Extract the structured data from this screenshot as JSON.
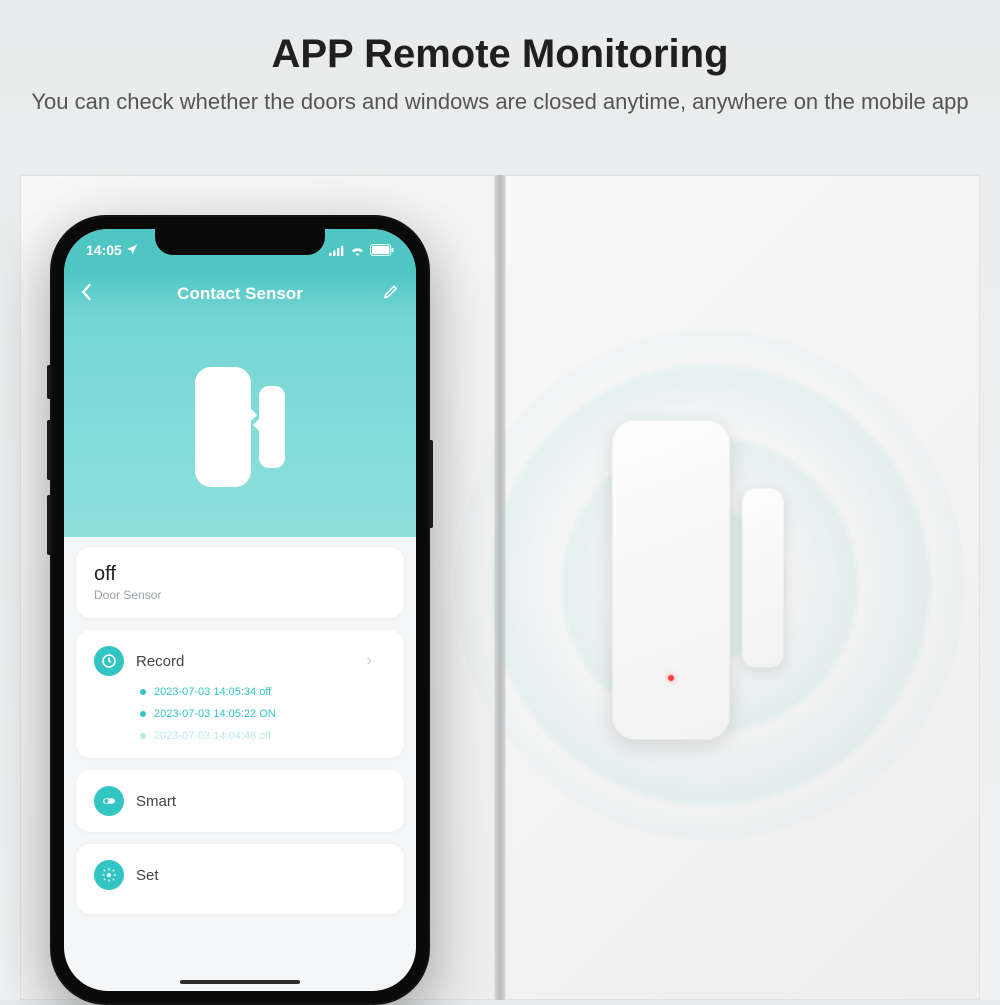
{
  "heading": {
    "title": "APP Remote Monitoring",
    "subtitle": "You can check whether the doors and windows are closed anytime, anywhere on the mobile app"
  },
  "phone": {
    "status_time": "14:05",
    "app_title": "Contact Sensor",
    "status_card": {
      "state": "off",
      "label": "Door Sensor"
    },
    "sections": {
      "record": {
        "label": "Record",
        "entries": [
          "2023-07-03 14:05:34 off",
          "2023-07-03 14:05:22 ON",
          "2023-07-03 14:04:48 off"
        ]
      },
      "smart": {
        "label": "Smart"
      },
      "set": {
        "label": "Set"
      }
    }
  }
}
